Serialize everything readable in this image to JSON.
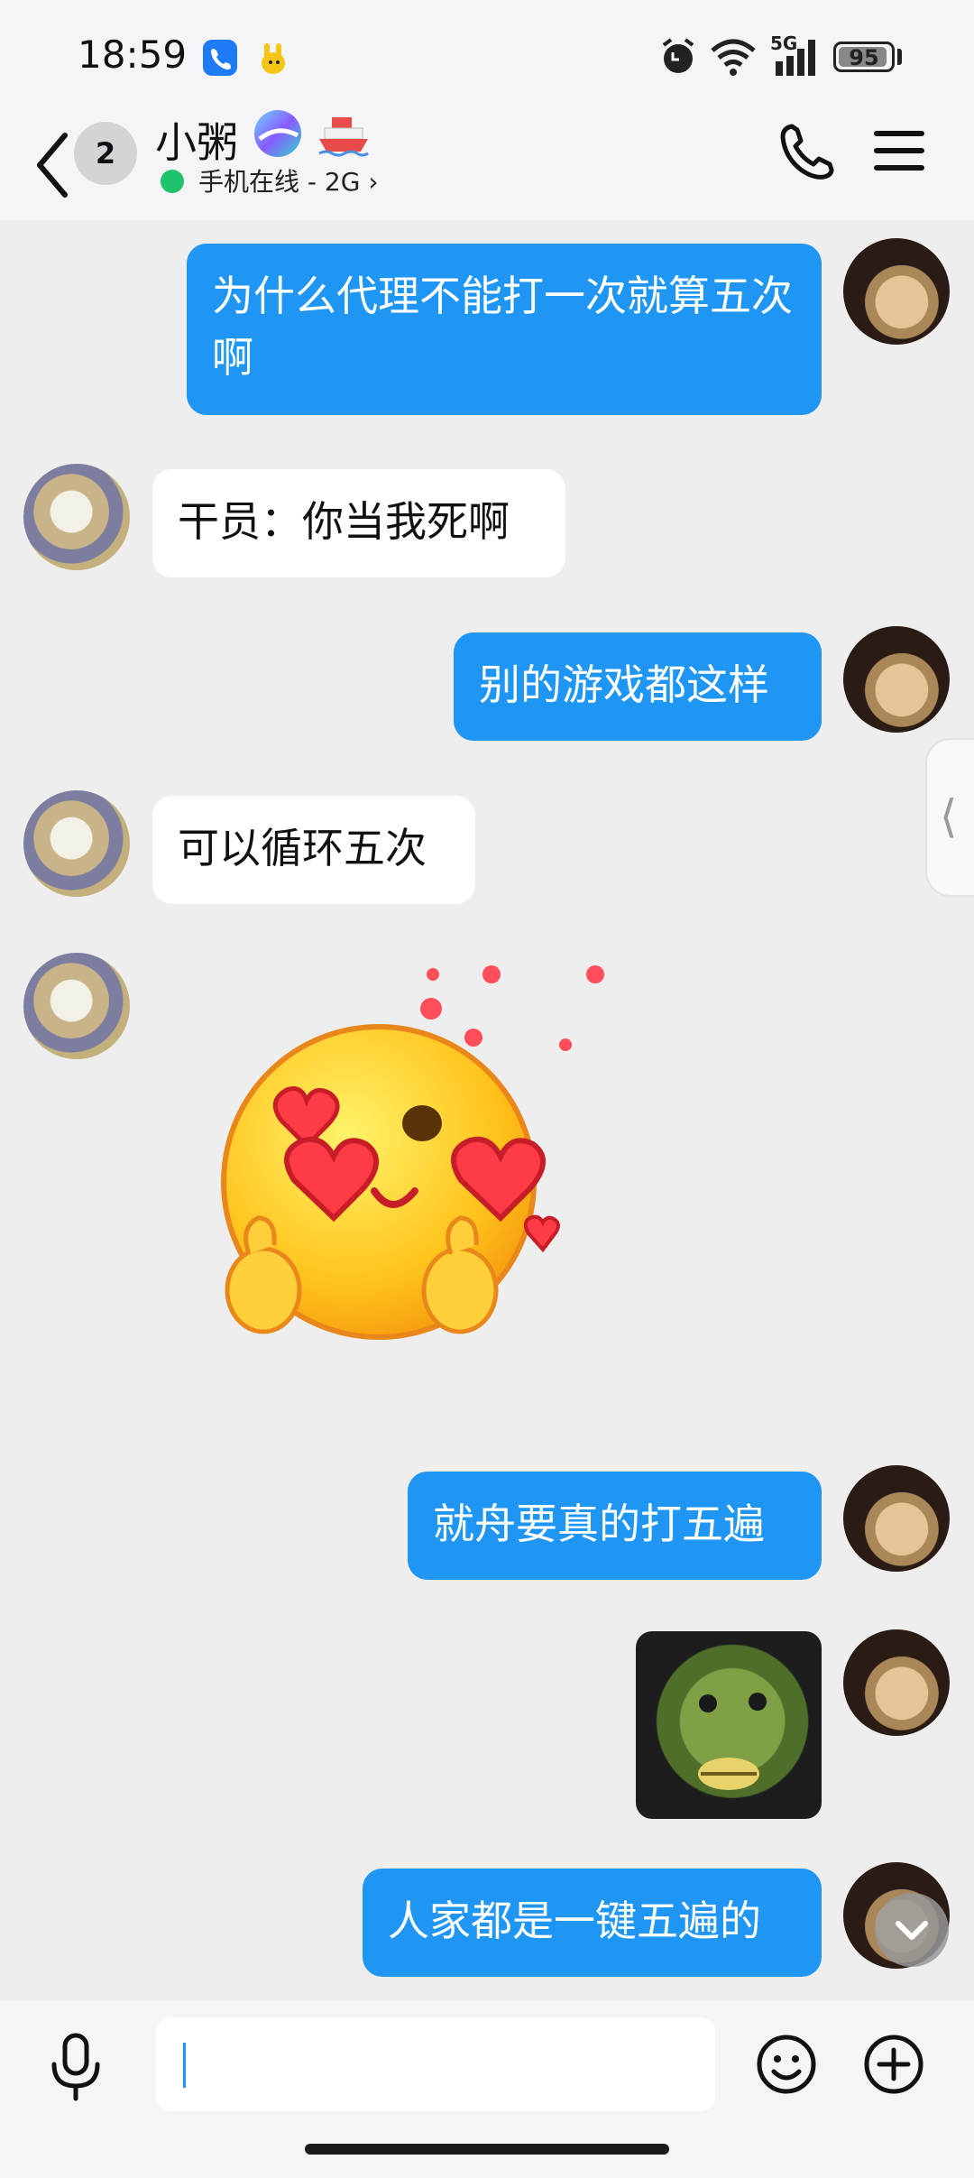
{
  "status_bar": {
    "time": "18:59",
    "network": "5G",
    "battery": "95",
    "battery_level": 0.95
  },
  "header": {
    "unread_count": "2",
    "contact_name": "小粥",
    "status_text": "手机在线 - 2G"
  },
  "messages": [
    {
      "sender": "me",
      "type": "text",
      "text": "为什么代理不能打一次就算五次啊"
    },
    {
      "sender": "other",
      "type": "text",
      "text": "干员：你当我死啊"
    },
    {
      "sender": "me",
      "type": "text",
      "text": "别的游戏都这样"
    },
    {
      "sender": "other",
      "type": "text",
      "text": "可以循环五次"
    },
    {
      "sender": "other",
      "type": "sticker",
      "sticker": "heart-eyes-finger-heart-sticker"
    },
    {
      "sender": "me",
      "type": "text",
      "text": "就舟要真的打五遍"
    },
    {
      "sender": "me",
      "type": "image",
      "image": "fish-mask-face-photo"
    },
    {
      "sender": "me",
      "type": "text",
      "text": "人家都是一键五遍的"
    }
  ],
  "input": {
    "value": "",
    "placeholder": ""
  },
  "colors": {
    "my_bubble": "#1f96f3",
    "their_bubble": "#ffffff",
    "background": "#efeeef",
    "online": "#1fc46a"
  }
}
